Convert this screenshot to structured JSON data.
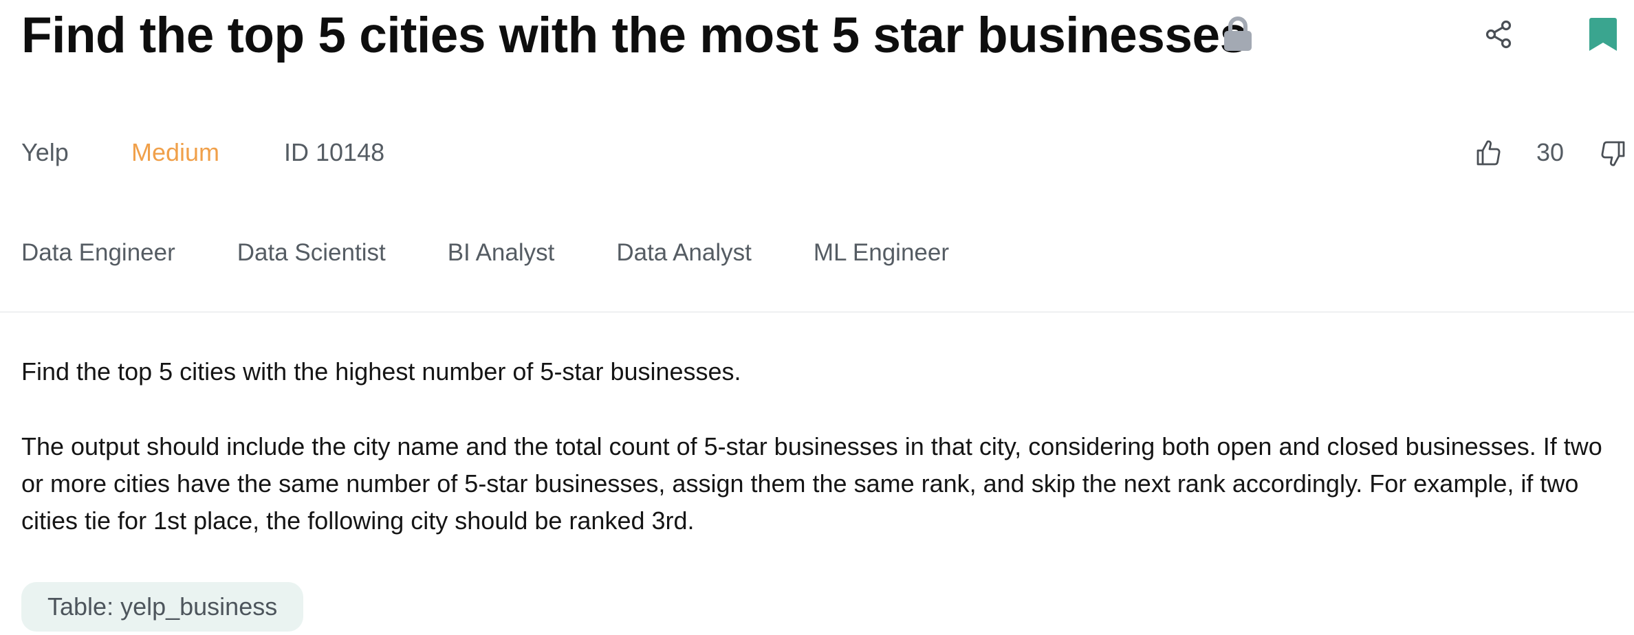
{
  "question": {
    "title": "Find the top 5 cities with the most 5 star businesses",
    "company": "Yelp",
    "difficulty": "Medium",
    "id_label": "ID 10148",
    "votes": "30"
  },
  "roles": [
    "Data Engineer",
    "Data Scientist",
    "BI Analyst",
    "Data Analyst",
    "ML Engineer"
  ],
  "description": {
    "paragraph1": "Find the top 5 cities with the highest number of 5-star businesses.",
    "paragraph2": "The output should include the city name and the total count of 5-star businesses in that city, considering both open and closed businesses. If two or more cities have the same number of 5-star businesses, assign them the same rank, and skip the next rank accordingly. For example, if two cities tie for 1st place, the following city should be ranked 3rd."
  },
  "table_chip": "Table: yelp_business",
  "icons": {
    "lock": "lock-icon",
    "share": "share-icon",
    "bookmark": "bookmark-icon",
    "thumbs_up": "thumbs-up-icon",
    "thumbs_down": "thumbs-down-icon"
  },
  "colors": {
    "title": "#0e0e0e",
    "difficulty_medium": "#f0a04a",
    "bookmark": "#3aa58f",
    "lock": "#a3a9b3",
    "chip_background": "#eaf3f1"
  }
}
